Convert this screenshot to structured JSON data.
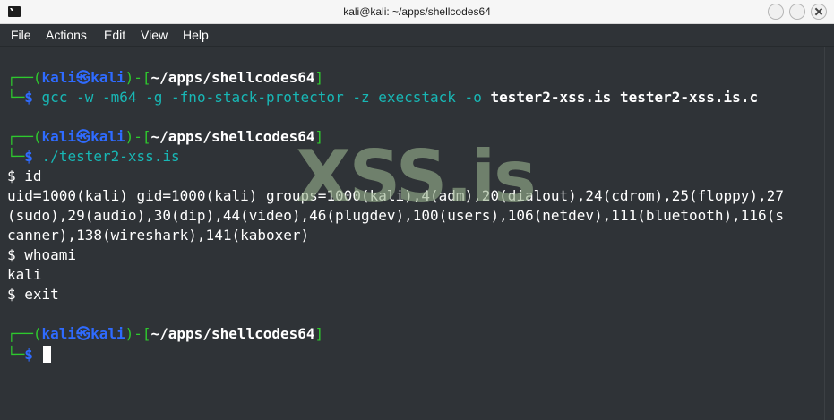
{
  "window": {
    "title": "kali@kali: ~/apps/shellcodes64"
  },
  "icons": {
    "app": "terminal-icon",
    "maximize": "maximize-icon",
    "minimize": "minimize-icon",
    "close": "close-icon"
  },
  "menu": [
    "File",
    "Actions",
    "Edit",
    "View",
    "Help"
  ],
  "prompt": {
    "corner_top": "┌──(",
    "user": "kali",
    "at": "㉿",
    "host": "kali",
    "paren_close": ")-[",
    "path": "~/apps/shellcodes64",
    "bracket_close": "]",
    "corner_bottom": "└─",
    "dollar": "$"
  },
  "commands": {
    "cmd1_prefix": "gcc -w -m64 -g -fno-stack-protector -z execstack -o ",
    "cmd1_out": "tester2-xss.is",
    "cmd1_space": " ",
    "cmd1_src": "tester2-xss.is.c",
    "cmd2": "./tester2-xss.is"
  },
  "output": [
    "$ id",
    "uid=1000(kali) gid=1000(kali) groups=1000(kali),4(adm),20(dialout),24(cdrom),25(floppy),27",
    "(sudo),29(audio),30(dip),44(video),46(plugdev),100(users),106(netdev),111(bluetooth),116(s",
    "canner),138(wireshark),141(kaboxer)",
    "$ whoami",
    "kali",
    "$ exit"
  ],
  "watermark": "XSS.is",
  "colors": {
    "terminal_bg": "#2f3337",
    "prompt_green": "#2ec92e",
    "prompt_blue": "#2f6bff",
    "command_cyan": "#18b7b5"
  }
}
